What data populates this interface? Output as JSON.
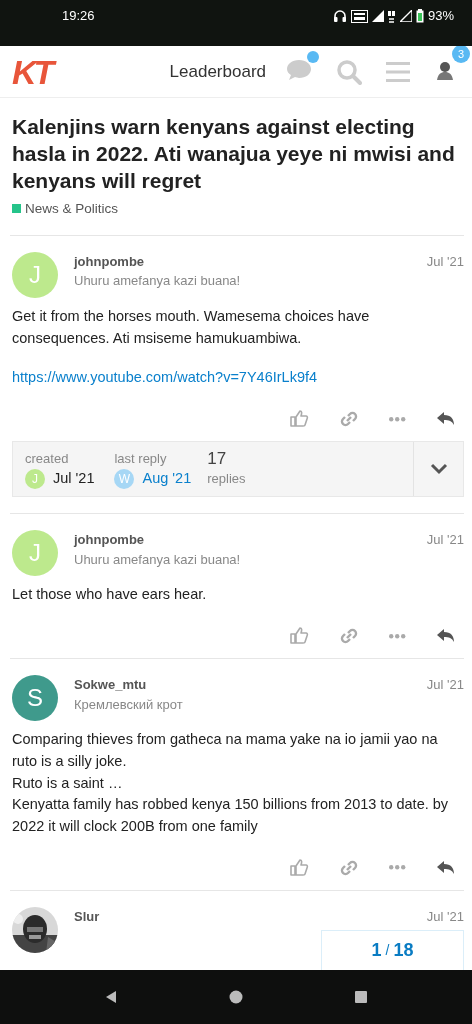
{
  "status_bar": {
    "time": "19:26",
    "battery": "93%"
  },
  "header": {
    "logo": "KT",
    "nav_link": "Leaderboard",
    "chat_unread": true,
    "notification_count": "3"
  },
  "topic": {
    "title": "Kalenjins warn kenyans against electing hasla in 2022. Ati wanajua yeye ni mwisi and kenyans will regret",
    "category": {
      "name": "News & Politics",
      "color": "#25c48a"
    }
  },
  "posts": [
    {
      "kind": "letter",
      "avatar_letter": "J",
      "color": "#bde98d",
      "username": "johnpombe",
      "user_title": "Uhuru amefanya kazi buana!",
      "date": "Jul '21",
      "paragraphs": [
        "Get it from the horses mouth. Wamesema choices have consequences. Ati msiseme hamukuambiwa."
      ],
      "link": "https://www.youtube.com/watch?v=7Y46IrLk9f4",
      "topic_map": {
        "created": {
          "label": "created",
          "letter": "J",
          "color": "#bde98d",
          "date": "Jul '21"
        },
        "last_reply": {
          "label": "last reply",
          "letter": "W",
          "color": "#a6d7f5",
          "date": "Aug '21"
        },
        "replies_count": "17",
        "replies_label": "replies"
      }
    },
    {
      "kind": "letter",
      "avatar_letter": "J",
      "color": "#bde98d",
      "username": "johnpombe",
      "user_title": "Uhuru amefanya kazi buana!",
      "date": "Jul '21",
      "paragraphs": [
        "Let those who have ears hear."
      ]
    },
    {
      "kind": "letter",
      "avatar_letter": "S",
      "color": "#3f9a8c",
      "username": "Sokwe_mtu",
      "user_title": "Кремлевский крот",
      "date": "Jul '21",
      "paragraphs": [
        "Comparing thieves from gatheca na mama yake na io jamii yao na ruto is a silly joke.",
        "Ruto is a saint …",
        "Kenyatta family has robbed kenya 150 billions from 2013 to date. by 2022 it will clock 200B from one family"
      ]
    },
    {
      "username": "Slur",
      "date": "Jul '21"
    }
  ],
  "progress": {
    "current": "1",
    "separator": "/",
    "total": "18"
  }
}
